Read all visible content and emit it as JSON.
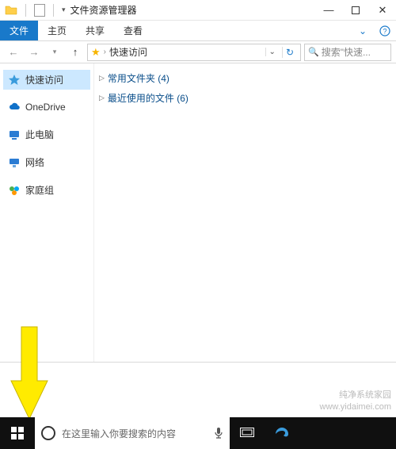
{
  "window": {
    "title": "文件资源管理器"
  },
  "ribbon": {
    "file": "文件",
    "home": "主页",
    "share": "共享",
    "view": "查看"
  },
  "nav": {
    "crumb": "快速访问",
    "search_placeholder": "搜索\"快速..."
  },
  "sidebar": {
    "quick": "快速访问",
    "onedrive": "OneDrive",
    "thispc": "此电脑",
    "network": "网络",
    "homegroup": "家庭组"
  },
  "content": {
    "freq": "常用文件夹 (4)",
    "recent": "最近使用的文件 (6)"
  },
  "taskbar": {
    "search_placeholder": "在这里输入你要搜索的内容"
  },
  "watermark": {
    "line1": "纯净系统家园",
    "line2": "www.yidaimei.com"
  }
}
